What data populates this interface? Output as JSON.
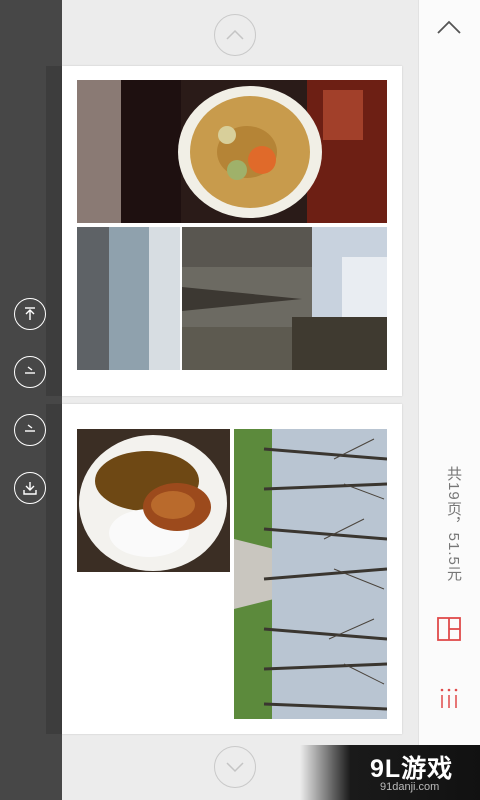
{
  "right_panel": {
    "page_info": "共19页，51.5元"
  },
  "watermark": {
    "title": "9L游戏",
    "url": "91danji.com"
  }
}
